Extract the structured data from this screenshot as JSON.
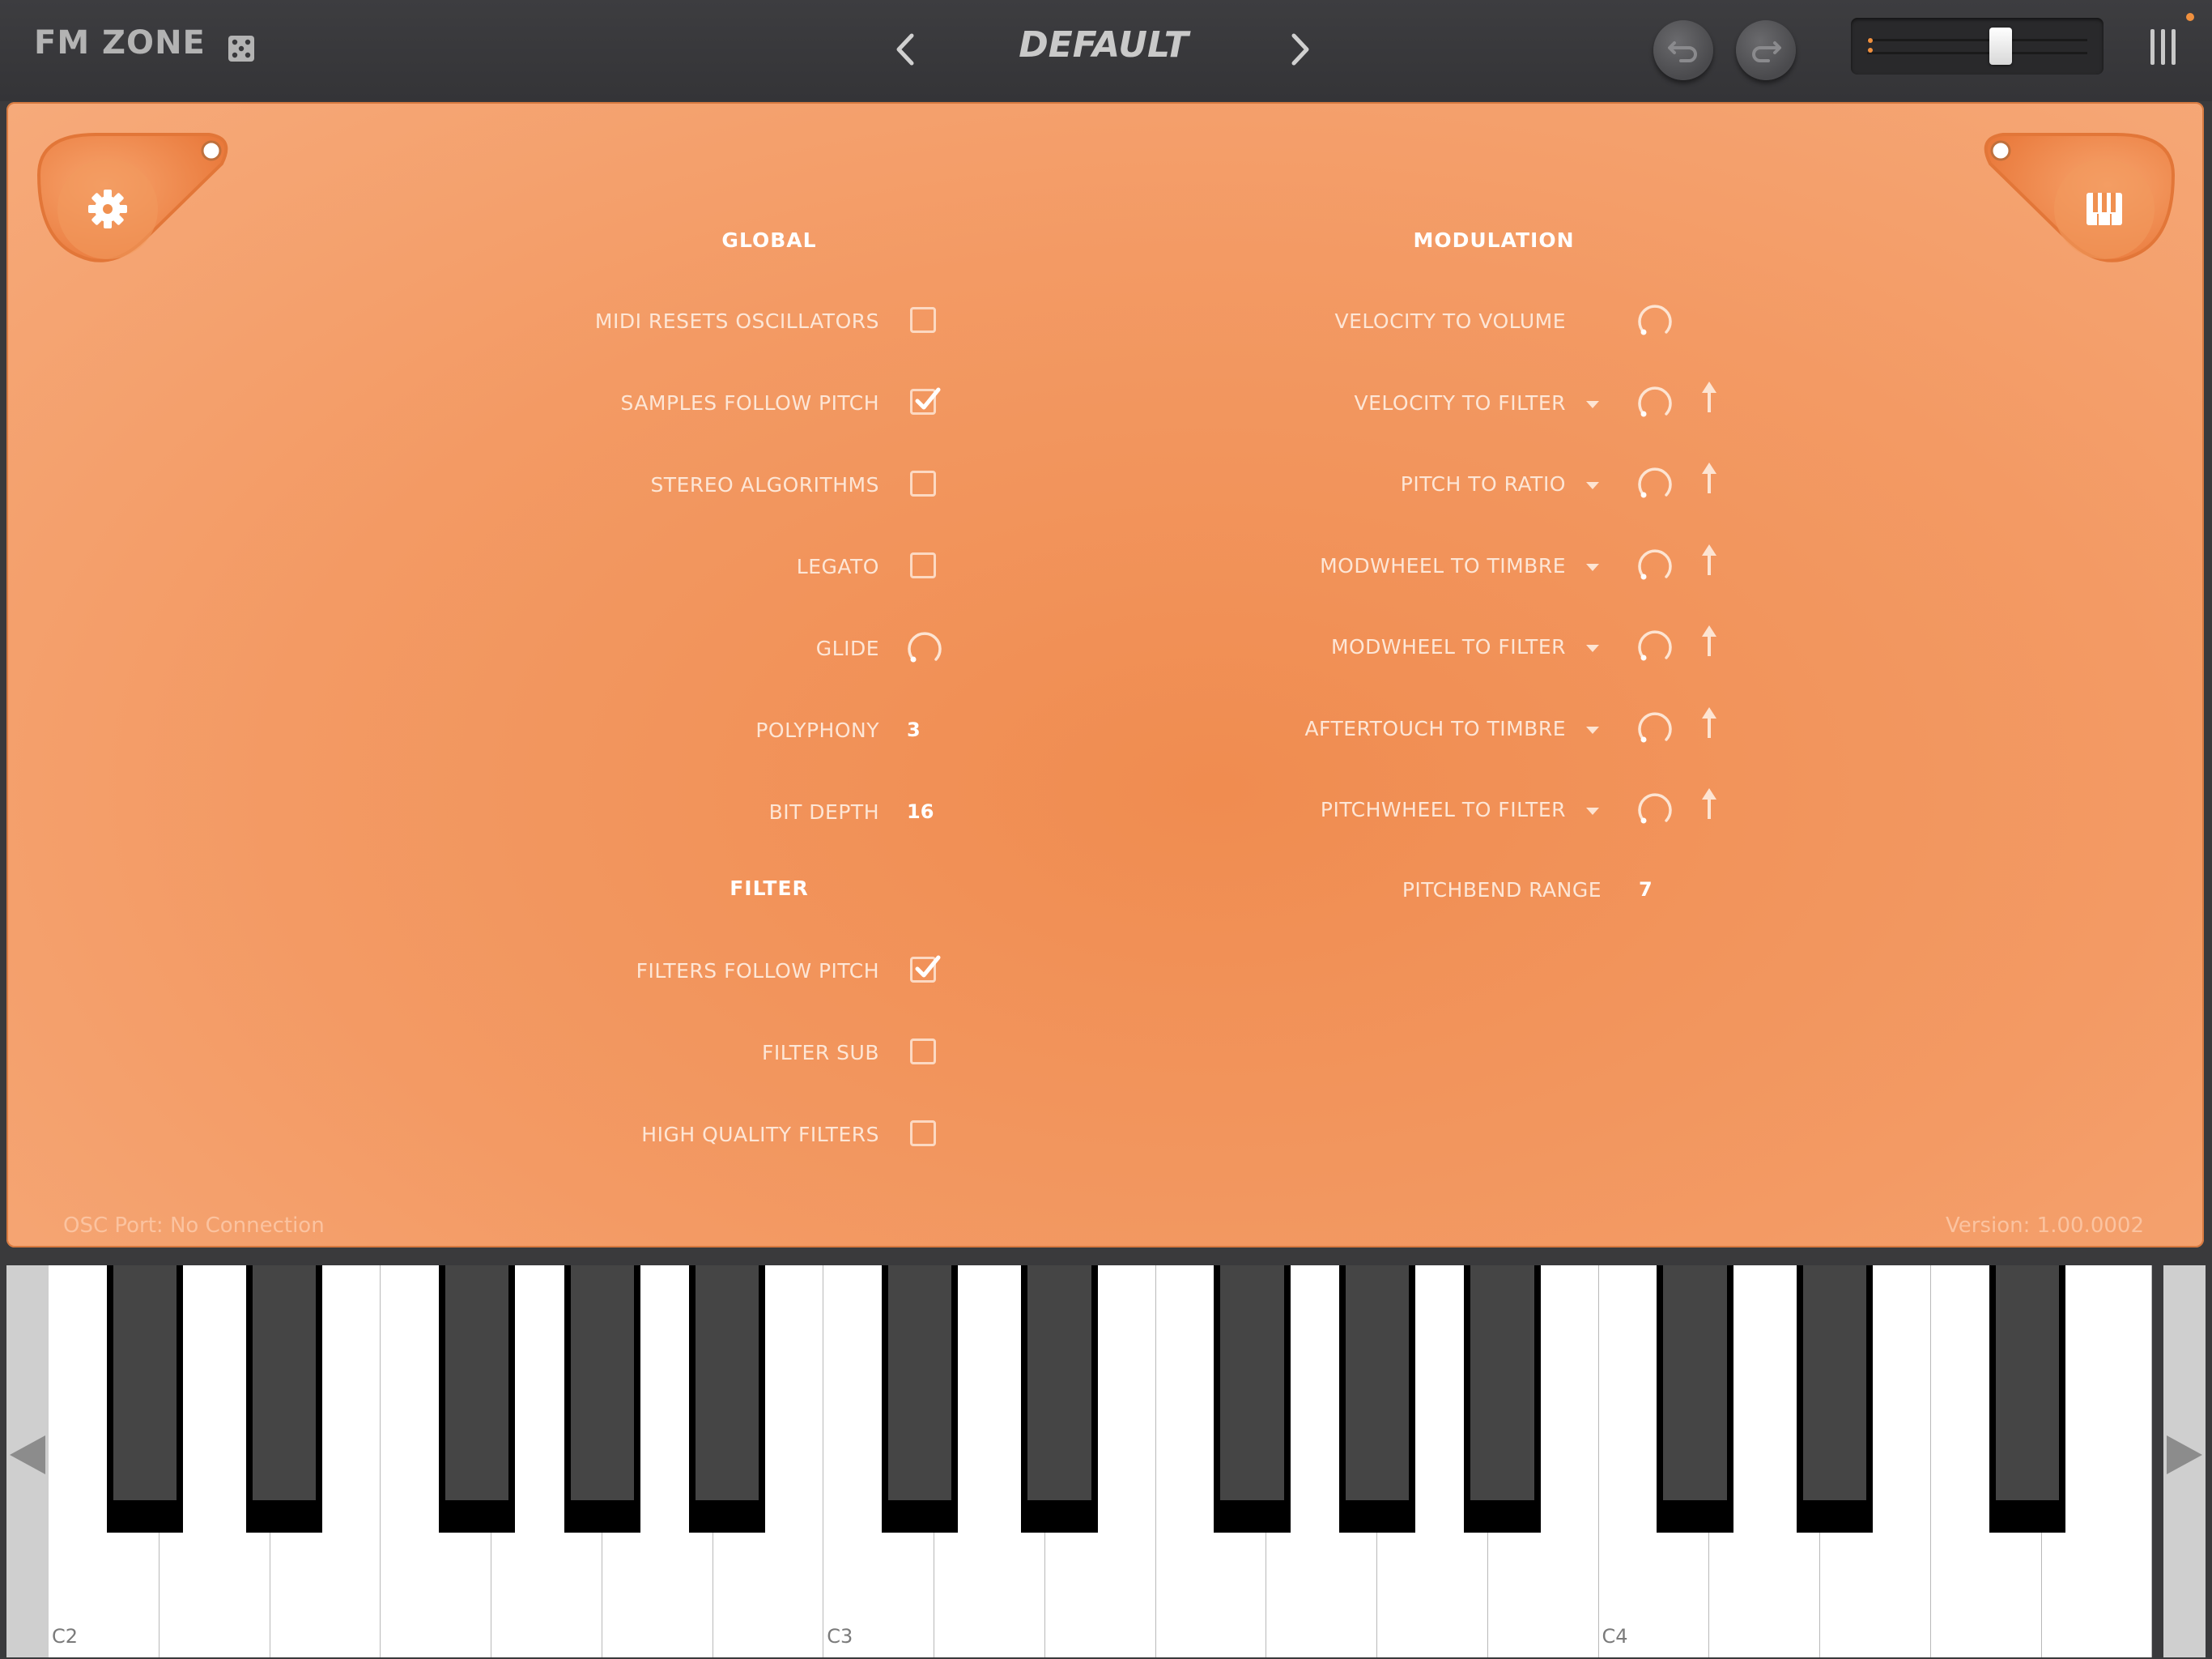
{
  "app": {
    "title": "FM ZONE"
  },
  "header": {
    "preset_name": "DEFAULT",
    "icons": [
      "dice-icon",
      "chevron-left-icon",
      "chevron-right-icon",
      "undo-icon",
      "redo-icon",
      "menu-icon"
    ],
    "volume": 0.62
  },
  "global": {
    "title": "GLOBAL",
    "rows": [
      {
        "label": "MIDI RESETS OSCILLATORS",
        "type": "checkbox",
        "checked": false
      },
      {
        "label": "SAMPLES FOLLOW PITCH",
        "type": "checkbox",
        "checked": true
      },
      {
        "label": "STEREO ALGORITHMS",
        "type": "checkbox",
        "checked": false
      },
      {
        "label": "LEGATO",
        "type": "checkbox",
        "checked": false
      },
      {
        "label": "GLIDE",
        "type": "knob",
        "value": 0
      },
      {
        "label": "POLYPHONY",
        "type": "value",
        "value": "3"
      },
      {
        "label": "BIT DEPTH",
        "type": "value",
        "value": "16"
      }
    ]
  },
  "filter": {
    "title": "FILTER",
    "rows": [
      {
        "label": "FILTERS FOLLOW PITCH",
        "type": "checkbox",
        "checked": true
      },
      {
        "label": "FILTER SUB",
        "type": "checkbox",
        "checked": false
      },
      {
        "label": "HIGH QUALITY FILTERS",
        "type": "checkbox",
        "checked": false
      }
    ]
  },
  "modulation": {
    "title": "MODULATION",
    "rows": [
      {
        "label": "VELOCITY TO VOLUME",
        "dropdown": false,
        "arrow": false
      },
      {
        "label": "VELOCITY TO FILTER",
        "dropdown": true,
        "arrow": true
      },
      {
        "label": "PITCH TO RATIO",
        "dropdown": true,
        "arrow": true
      },
      {
        "label": "MODWHEEL TO TIMBRE",
        "dropdown": true,
        "arrow": true
      },
      {
        "label": "MODWHEEL TO FILTER",
        "dropdown": true,
        "arrow": true
      },
      {
        "label": "AFTERTOUCH TO TIMBRE",
        "dropdown": true,
        "arrow": true
      },
      {
        "label": "PITCHWHEEL TO FILTER",
        "dropdown": true,
        "arrow": true
      }
    ],
    "pitchbend": {
      "label": "PITCHBEND RANGE",
      "value": "7"
    }
  },
  "footer": {
    "osc_port": "OSC Port: No Connection",
    "version": "Version: 1.00.0002"
  },
  "keyboard": {
    "octave_labels": [
      "C2",
      "C3",
      "C4"
    ],
    "white_key_count": 19
  },
  "colors": {
    "panel_orange": "#f39a64",
    "accent": "#f0903e",
    "topbar": "#3a3a3c"
  }
}
